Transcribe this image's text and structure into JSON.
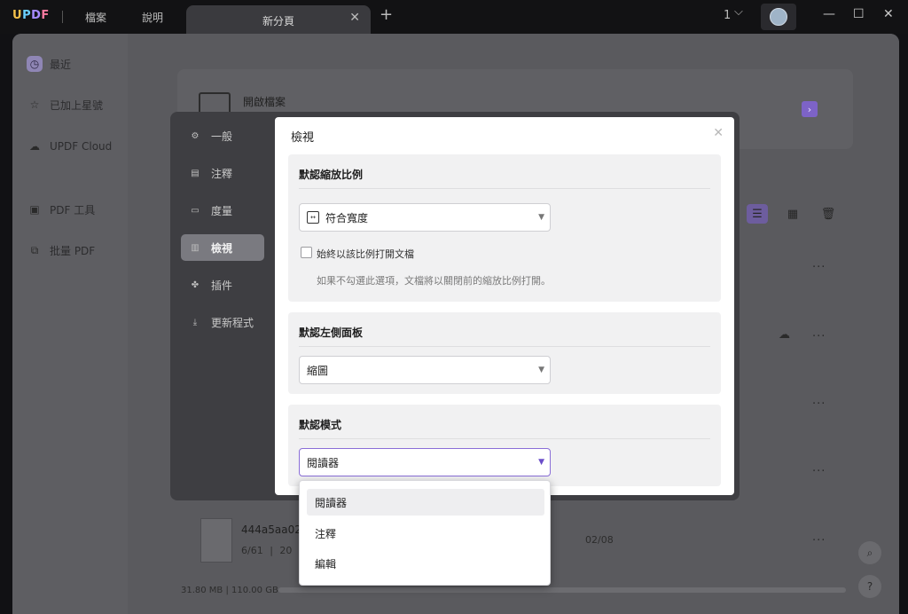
{
  "titlebar": {
    "logo": {
      "u": "U",
      "p": "P",
      "d": "D",
      "f": "F"
    },
    "menus": [
      "檔案",
      "說明"
    ],
    "tab_label": "新分頁",
    "tab_count": "1"
  },
  "sidebar": {
    "items": [
      {
        "label": "最近",
        "icon": "clock-icon"
      },
      {
        "label": "已加上星號",
        "icon": "star-icon"
      },
      {
        "label": "UPDF Cloud",
        "icon": "cloud-icon"
      },
      {
        "label": "PDF 工具",
        "icon": "toolbox-icon"
      },
      {
        "label": "批量 PDF",
        "icon": "batch-icon"
      }
    ]
  },
  "main": {
    "open_file_label": "開啟檔案",
    "file": {
      "name": "444a5aa02a",
      "pages": "6/61",
      "size": "20",
      "date": "02/08"
    },
    "storage_text": "31.80 MB | 110.00 GB"
  },
  "prefs": {
    "nav": [
      {
        "label": "一般",
        "icon": "gear-icon"
      },
      {
        "label": "注釋",
        "icon": "comment-icon"
      },
      {
        "label": "度量",
        "icon": "ruler-icon"
      },
      {
        "label": "檢視",
        "icon": "view-icon",
        "active": true
      },
      {
        "label": "插件",
        "icon": "puzzle-icon"
      },
      {
        "label": "更新程式",
        "icon": "download-icon"
      }
    ],
    "panel_title": "檢視",
    "zoom": {
      "title": "默認縮放比例",
      "value": "符合寬度",
      "checkbox_label": "始終以該比例打開文檔",
      "hint": "如果不勾選此選項，文檔將以關閉前的縮放比例打開。"
    },
    "left_panel": {
      "title": "默認左側面板",
      "value": "縮圖"
    },
    "mode": {
      "title": "默認模式",
      "value": "閱讀器",
      "options": [
        "閱讀器",
        "注釋",
        "編輯"
      ]
    }
  },
  "colors": {
    "accent": "#8a6ed8"
  }
}
